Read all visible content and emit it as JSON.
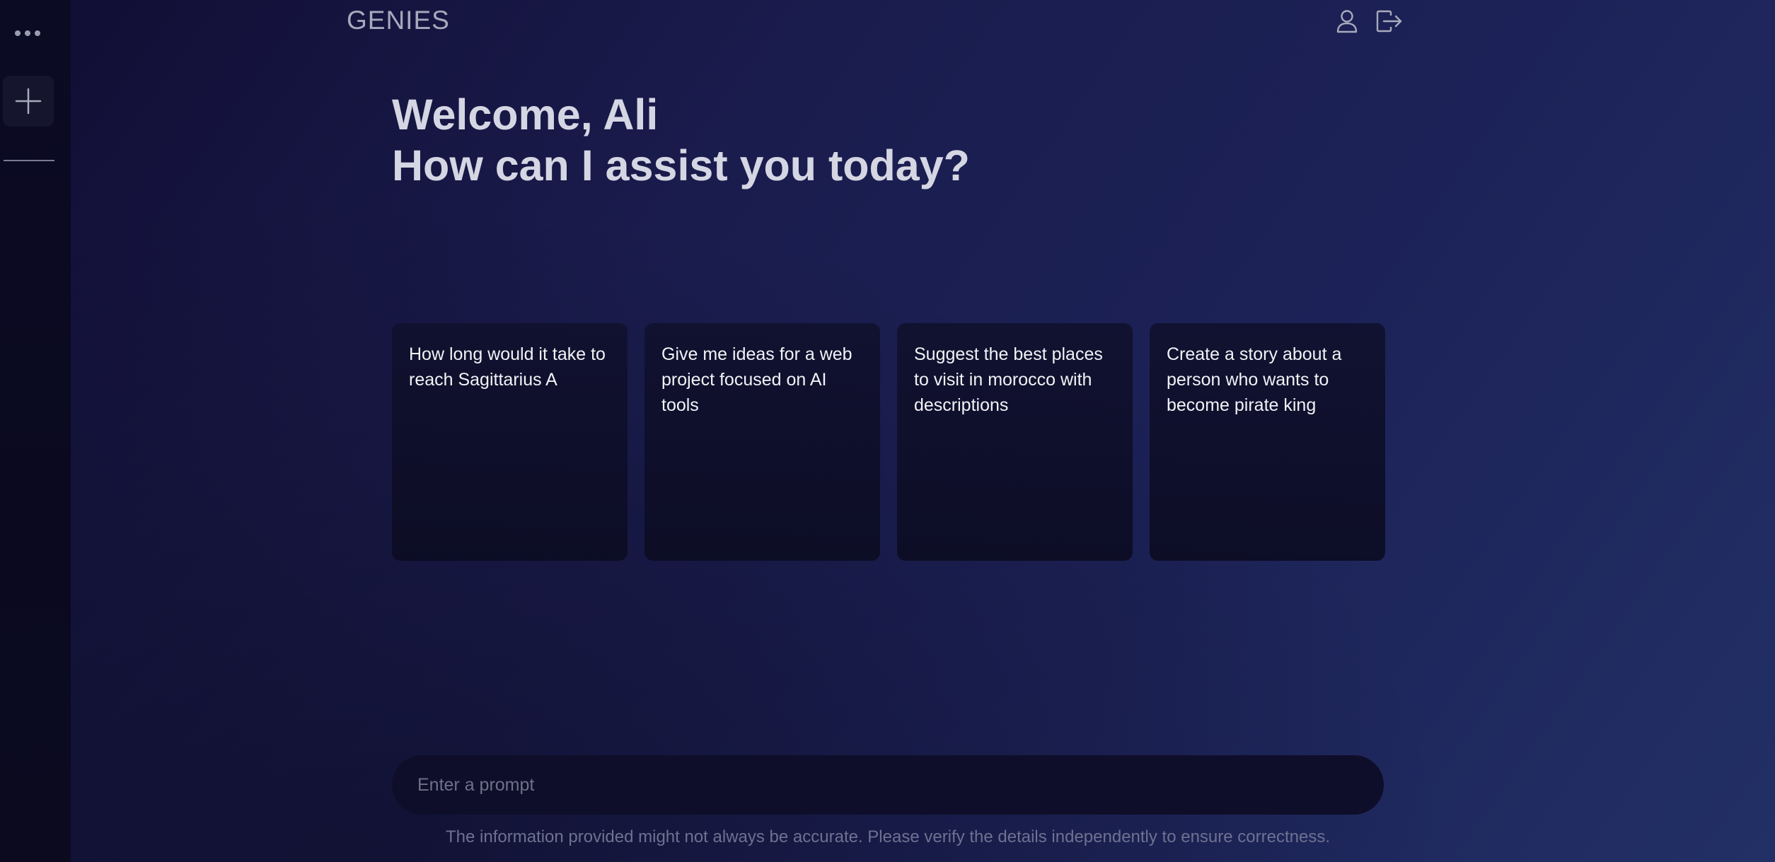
{
  "app": {
    "brand": "GENIES"
  },
  "sidebar": {
    "more_icon": "more-horizontal-icon",
    "new_chat_icon": "plus-icon"
  },
  "header": {
    "user_icon": "user-icon",
    "logout_icon": "logout-icon"
  },
  "greeting": {
    "line1": "Welcome, Ali",
    "line2": "How can I assist you today?"
  },
  "suggestions": [
    {
      "text": "How long would it take to reach Sagittarius A"
    },
    {
      "text": "Give me ideas for a web project focused on AI tools"
    },
    {
      "text": "Suggest the best places to visit in morocco with descriptions"
    },
    {
      "text": "Create a story about a person who wants to become pirate king"
    }
  ],
  "prompt": {
    "placeholder": "Enter a prompt",
    "value": ""
  },
  "disclaimer": "The information provided might not always be accurate. Please verify the details independently to ensure correctness.",
  "colors": {
    "background_start": "#110d33",
    "background_end": "#223066",
    "sidebar": "#0b0a21",
    "card": "#0f102b",
    "text_primary": "#d5d6e3",
    "text_muted": "#6e7190"
  }
}
